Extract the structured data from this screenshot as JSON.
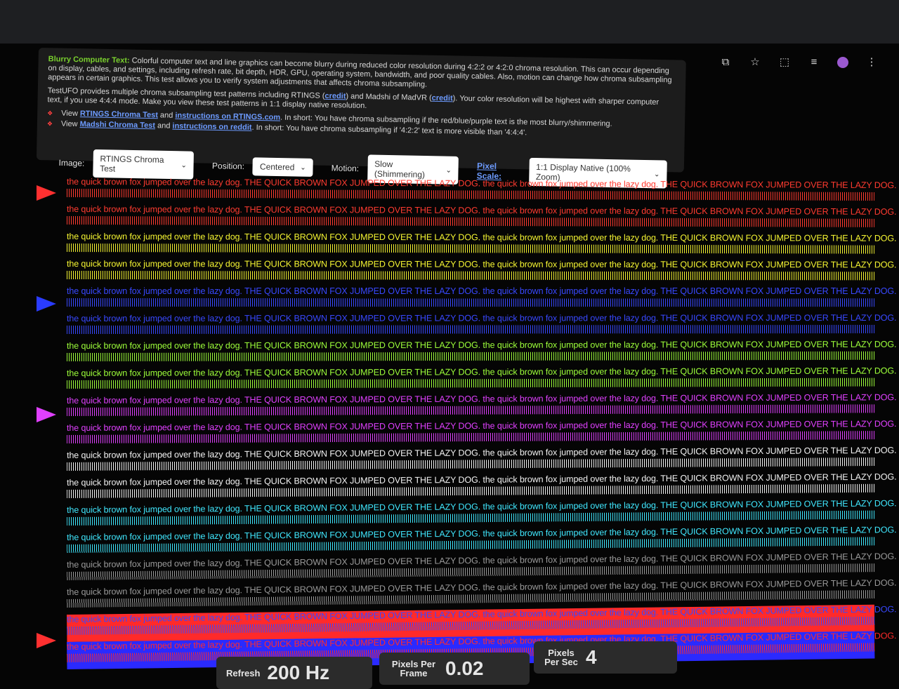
{
  "info": {
    "heading": "Blurry Computer Text:",
    "para1": "Colorful computer text and line graphics can become blurry during reduced color resolution during 4:2:2 or 4:2:0 chroma resolution. This can occur depending on display, cables, and settings, including refresh rate, bit depth, HDR, GPU, operating system, bandwidth, and poor quality cables. Also, motion can change how chroma subsampling appears in certain graphics. This test allows you to verify system adjustments that affects chroma subsampling.",
    "para2a": "TestUFO provides multiple chroma subsampling test patterns including RTINGS (",
    "credit1": "credit",
    "para2b": ") and Madshi of MadVR (",
    "credit2": "credit",
    "para2c": "). Your color resolution will be highest with sharper computer text, if you use 4:4:4 mode. Make you view these test patterns in 1:1 display native resolution.",
    "b1_view": "View",
    "b1_link1": "RTINGS Chroma Test",
    "b1_and": "and",
    "b1_link2": "instructions on RTINGS.com",
    "b1_rest": ". In short: You have chroma subsampling if the red/blue/purple text is the most blurry/shimmering.",
    "b2_view": "View",
    "b2_link1": "Madshi Chroma Test",
    "b2_and": "and",
    "b2_link2": "instructions on reddit",
    "b2_rest": ". In short: You have chroma subsampling if '4:2:2' text is more visible than '4:4:4'."
  },
  "controls": {
    "image_label": "Image:",
    "image_value": "RTINGS Chroma Test",
    "position_label": "Position:",
    "position_value": "Centered",
    "motion_label": "Motion:",
    "motion_value": "Slow (Shimmering)",
    "pixel_scale_label": "Pixel Scale:",
    "pixel_scale_value": "1:1 Display Native (100% Zoom)"
  },
  "pattern_text": "the quick brown fox jumped over the lazy dog. THE QUICK BROWN FOX JUMPED OVER THE LAZY DOG. the quick brown fox jumped over the lazy dog. THE QUICK BROWN FOX JUMPED OVER THE LAZY DOG.",
  "rows": [
    {
      "color": "#ff3b30",
      "bg": ""
    },
    {
      "color": "#ff3b30",
      "bg": ""
    },
    {
      "color": "#f5f532",
      "bg": ""
    },
    {
      "color": "#f5f532",
      "bg": ""
    },
    {
      "color": "#3848ff",
      "bg": ""
    },
    {
      "color": "#3848ff",
      "bg": ""
    },
    {
      "color": "#9dff3a",
      "bg": ""
    },
    {
      "color": "#9dff3a",
      "bg": ""
    },
    {
      "color": "#e040ff",
      "bg": ""
    },
    {
      "color": "#e040ff",
      "bg": ""
    },
    {
      "color": "#f2f2f2",
      "bg": ""
    },
    {
      "color": "#f2f2f2",
      "bg": ""
    },
    {
      "color": "#40e8ff",
      "bg": ""
    },
    {
      "color": "#40e8ff",
      "bg": ""
    },
    {
      "color": "#9a9a9a",
      "bg": ""
    },
    {
      "color": "#9a9a9a",
      "bg": ""
    },
    {
      "color": "#3848ff",
      "bg": "#ff2a2a"
    },
    {
      "color": "#ff2a2a",
      "bg": "#2a2aff"
    }
  ],
  "markers": [
    "#ff3030",
    "#2a3cff",
    "#e040ff",
    "#ff3030"
  ],
  "stats": {
    "refresh_label": "Refresh",
    "refresh_value": "200 Hz",
    "ppf_label": "Pixels Per Frame",
    "ppf_value": "0.02",
    "pps_label": "Pixels Per Sec",
    "pps_value": "4"
  }
}
